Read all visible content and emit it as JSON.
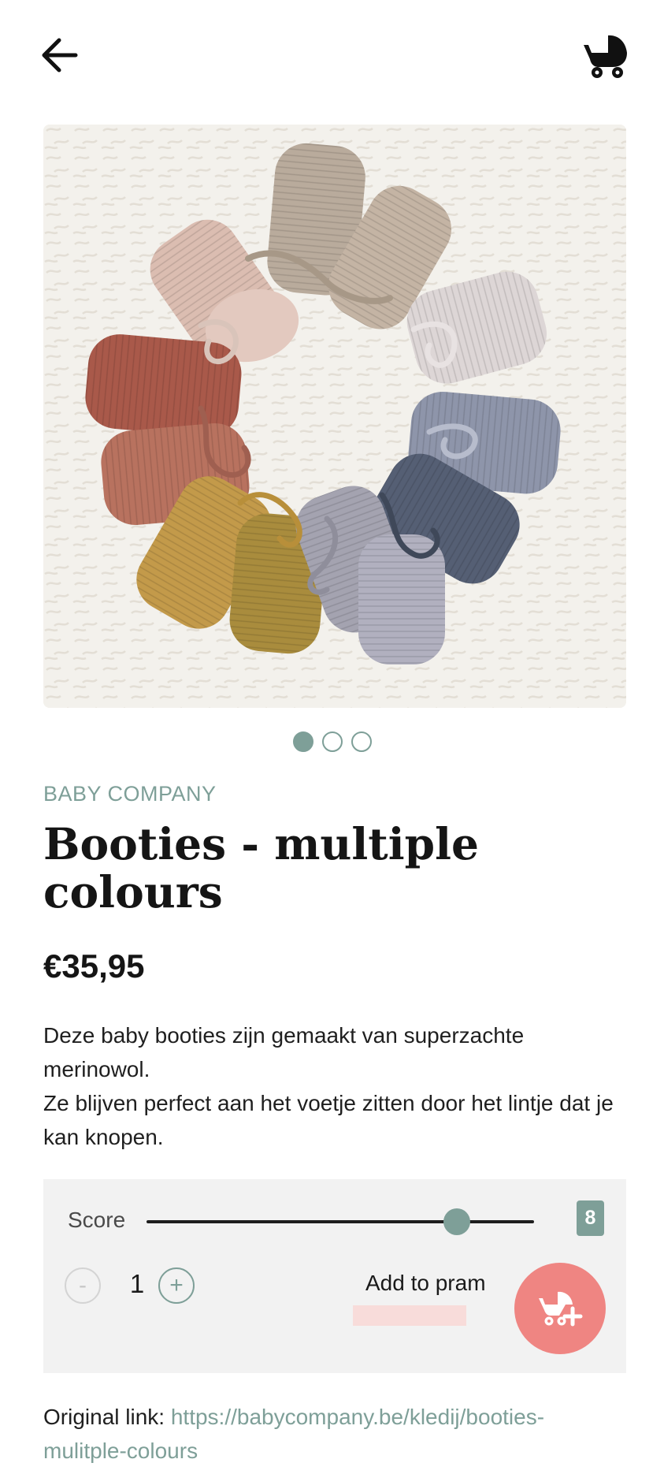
{
  "header": {
    "back_icon": "arrow-left-icon",
    "pram_icon": "baby-carriage-icon"
  },
  "gallery": {
    "image_alt": "Knitted baby booties in multiple colours arranged in a circle on white sheepskin",
    "slide_count": 3,
    "active_slide": 1,
    "colors": {
      "accent": "#7e9f98",
      "action": "#ef8582"
    }
  },
  "product": {
    "brand": "BABY COMPANY",
    "title": "Booties - multiple colours",
    "price": "€35,95",
    "description_line1": "Deze baby booties zijn gemaakt van superzachte merinowol.",
    "description_line2": "Ze blijven perfect aan het voetje zitten door het lintje dat je kan knopen."
  },
  "panel": {
    "score_label": "Score",
    "score_value": "8",
    "score_fraction": 0.8,
    "quantity_minus": "-",
    "quantity": "1",
    "quantity_plus": "+",
    "add_label": "Add to pram",
    "add_icon": "add-to-pram-icon"
  },
  "footer": {
    "original_label": "Original link:",
    "original_url": "https://babycompany.be/kledij/booties-mulitple-colours"
  }
}
